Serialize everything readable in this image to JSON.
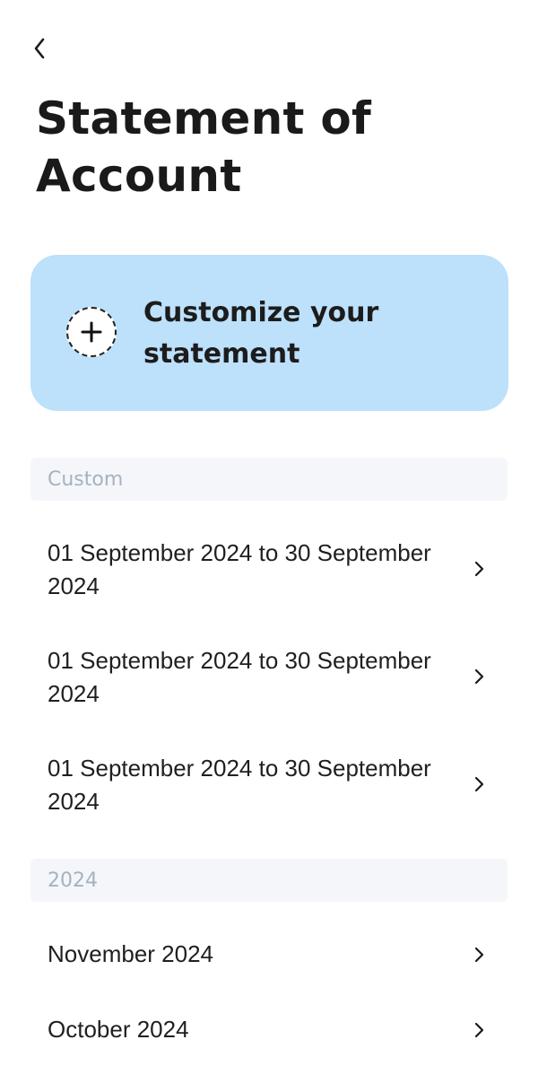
{
  "header": {
    "back_icon": "chevron-left-icon",
    "title": "Statement of Account"
  },
  "customize_card": {
    "icon": "plus-circle-icon",
    "label": "Customize your statement",
    "background_color": "#bde0fb"
  },
  "sections": [
    {
      "header": "Custom",
      "items": [
        {
          "label": "01 September 2024 to 30 September 2024",
          "icon": "chevron-right-icon"
        },
        {
          "label": "01 September 2024 to 30 September 2024",
          "icon": "chevron-right-icon"
        },
        {
          "label": "01 September 2024 to 30 September 2024",
          "icon": "chevron-right-icon"
        }
      ]
    },
    {
      "header": "2024",
      "items": [
        {
          "label": "November 2024",
          "icon": "chevron-right-icon"
        },
        {
          "label": "October 2024",
          "icon": "chevron-right-icon"
        }
      ]
    }
  ]
}
